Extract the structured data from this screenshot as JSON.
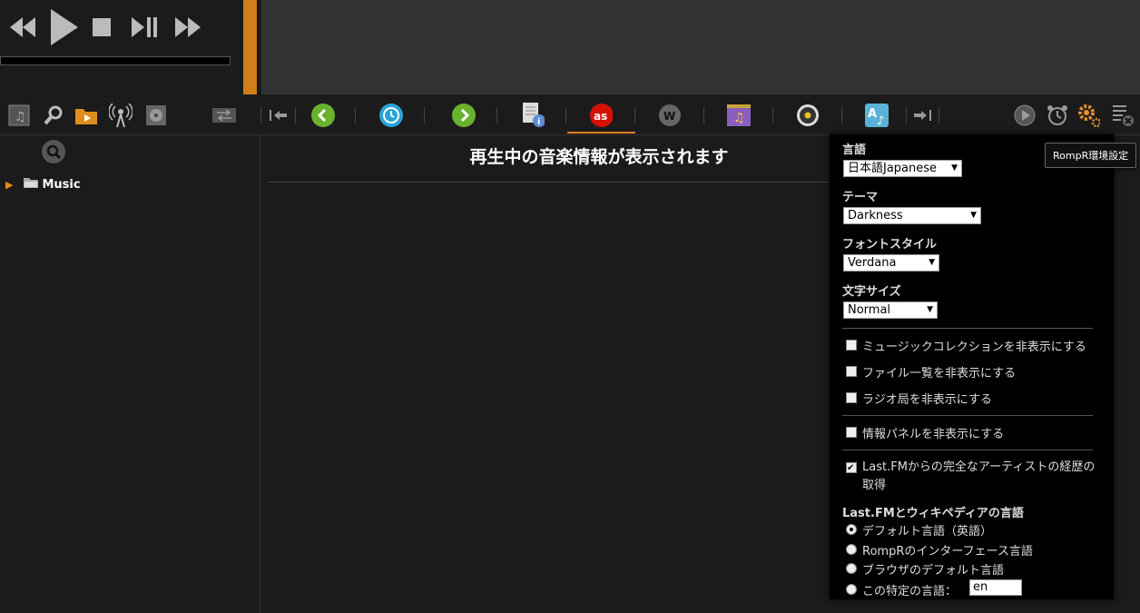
{
  "player": {
    "controls": [
      "previous",
      "play",
      "stop",
      "play-pause",
      "next"
    ]
  },
  "toolbar": {
    "left_icons": [
      "music-library-icon",
      "search-icon",
      "folder-icon",
      "radio-icon",
      "disc-icon",
      "shuffle-icon"
    ],
    "tabs": [
      "nowplaying-info-icon",
      "lastfm-icon",
      "wikipedia-icon",
      "musicbrainz-icon",
      "discogs-icon",
      "lyrics-icon"
    ],
    "accent": "#e67e22"
  },
  "library": {
    "root_label": "Music"
  },
  "main": {
    "title": "再生中の音楽情報が表示されます"
  },
  "prefs": {
    "language_label": "言語",
    "language_value": "日本語Japanese",
    "theme_label": "テーマ",
    "theme_value": "Darkness",
    "font_label": "フォントスタイル",
    "font_value": "Verdana",
    "fontsize_label": "文字サイズ",
    "fontsize_value": "Normal",
    "hide_collection": "ミュージックコレクションを非表示にする",
    "hide_files": "ファイル一覧を非表示にする",
    "hide_radio": "ラジオ局を非表示にする",
    "hide_info": "情報パネルを非表示にする",
    "lastfm_full": "Last.FMからの完全なアーティストの経歴の取得",
    "lang_section": "Last.FMとウィキペディアの言語",
    "radio_default": "デフォルト言語（英語）",
    "radio_interface": "RompRのインターフェース言語",
    "radio_browser": "ブラウザのデフォルト言語",
    "radio_specific": "この特定の言語：",
    "specific_value": "en"
  },
  "tooltip": "RompR環境設定"
}
